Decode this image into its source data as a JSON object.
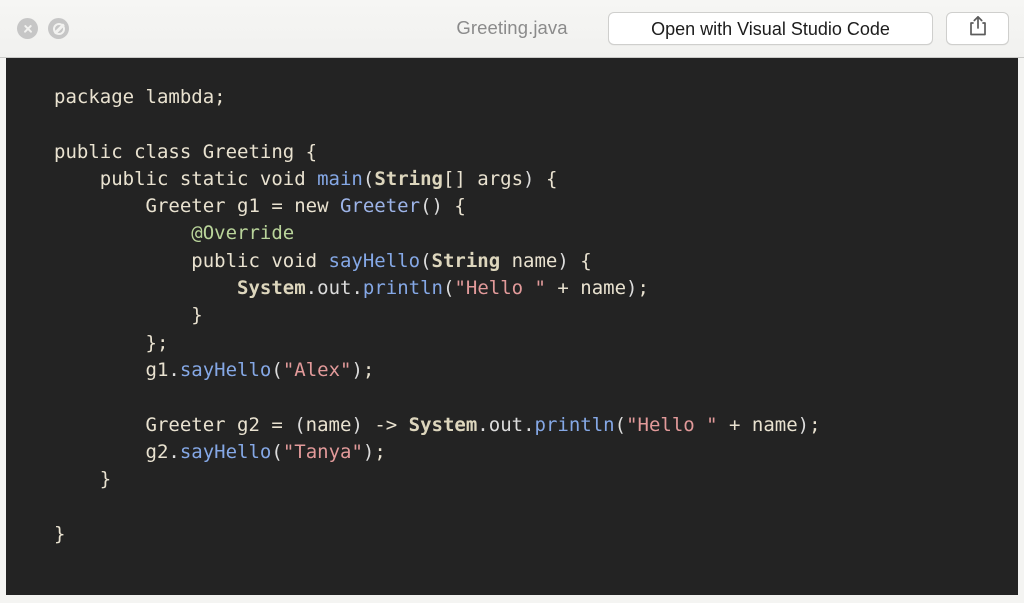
{
  "window": {
    "title": "Greeting.java"
  },
  "toolbar": {
    "close_button_icon": "close-x-icon",
    "disabled_button_icon": "prohibited-icon",
    "title": "Greeting.java",
    "open_with_label": "Open with Visual Studio Code",
    "share_icon": "share-upload-icon"
  },
  "code": {
    "language": "java",
    "background": "#232323",
    "default_color": "#e9e2d0",
    "colors": {
      "keyword": "#e9e2d0",
      "type": "#ddd6bd",
      "function": "#85a8e6",
      "class": "#9db4e8",
      "annotation": "#b9d49a",
      "string": "#e29a9a",
      "punctuation": "#dcdcdc"
    },
    "lines": [
      [
        {
          "t": "package lambda;",
          "c": "t-plain"
        }
      ],
      [],
      [
        {
          "t": "public class Greeting {",
          "c": "t-plain"
        }
      ],
      [
        {
          "t": "    public static void ",
          "c": "t-plain"
        },
        {
          "t": "main",
          "c": "t-fn"
        },
        {
          "t": "(",
          "c": "t-punct"
        },
        {
          "t": "String",
          "c": "t-type"
        },
        {
          "t": "[] args",
          "c": "t-plain"
        },
        {
          "t": ")",
          "c": "t-punct"
        },
        {
          "t": " {",
          "c": "t-plain"
        }
      ],
      [
        {
          "t": "        Greeter g1 = new ",
          "c": "t-plain"
        },
        {
          "t": "Greeter",
          "c": "t-cls"
        },
        {
          "t": "()",
          "c": "t-punct"
        },
        {
          "t": " {",
          "c": "t-plain"
        }
      ],
      [
        {
          "t": "            ",
          "c": "t-plain"
        },
        {
          "t": "@Override",
          "c": "t-ann"
        }
      ],
      [
        {
          "t": "            public void ",
          "c": "t-plain"
        },
        {
          "t": "sayHello",
          "c": "t-fn"
        },
        {
          "t": "(",
          "c": "t-punct"
        },
        {
          "t": "String",
          "c": "t-type"
        },
        {
          "t": " name",
          "c": "t-plain"
        },
        {
          "t": ")",
          "c": "t-punct"
        },
        {
          "t": " {",
          "c": "t-plain"
        }
      ],
      [
        {
          "t": "                ",
          "c": "t-plain"
        },
        {
          "t": "System",
          "c": "t-type"
        },
        {
          "t": ".",
          "c": "t-punct"
        },
        {
          "t": "out",
          "c": "t-punct"
        },
        {
          "t": ".",
          "c": "t-punct"
        },
        {
          "t": "println",
          "c": "t-fn"
        },
        {
          "t": "(",
          "c": "t-punct"
        },
        {
          "t": "\"Hello \"",
          "c": "t-str"
        },
        {
          "t": " + name",
          "c": "t-plain"
        },
        {
          "t": ")",
          "c": "t-punct"
        },
        {
          "t": ";",
          "c": "t-plain"
        }
      ],
      [
        {
          "t": "            }",
          "c": "t-plain"
        }
      ],
      [
        {
          "t": "        };",
          "c": "t-plain"
        }
      ],
      [
        {
          "t": "        g1",
          "c": "t-plain"
        },
        {
          "t": ".",
          "c": "t-punct"
        },
        {
          "t": "sayHello",
          "c": "t-fn"
        },
        {
          "t": "(",
          "c": "t-punct"
        },
        {
          "t": "\"Alex\"",
          "c": "t-str"
        },
        {
          "t": ")",
          "c": "t-punct"
        },
        {
          "t": ";",
          "c": "t-plain"
        }
      ],
      [],
      [
        {
          "t": "        Greeter g2 = ",
          "c": "t-plain"
        },
        {
          "t": "(",
          "c": "t-punct"
        },
        {
          "t": "name",
          "c": "t-plain"
        },
        {
          "t": ")",
          "c": "t-punct"
        },
        {
          "t": " -> ",
          "c": "t-plain"
        },
        {
          "t": "System",
          "c": "t-type"
        },
        {
          "t": ".",
          "c": "t-punct"
        },
        {
          "t": "out",
          "c": "t-punct"
        },
        {
          "t": ".",
          "c": "t-punct"
        },
        {
          "t": "println",
          "c": "t-fn"
        },
        {
          "t": "(",
          "c": "t-punct"
        },
        {
          "t": "\"Hello \"",
          "c": "t-str"
        },
        {
          "t": " + name",
          "c": "t-plain"
        },
        {
          "t": ")",
          "c": "t-punct"
        },
        {
          "t": ";",
          "c": "t-plain"
        }
      ],
      [
        {
          "t": "        g2",
          "c": "t-plain"
        },
        {
          "t": ".",
          "c": "t-punct"
        },
        {
          "t": "sayHello",
          "c": "t-fn"
        },
        {
          "t": "(",
          "c": "t-punct"
        },
        {
          "t": "\"Tanya\"",
          "c": "t-str"
        },
        {
          "t": ")",
          "c": "t-punct"
        },
        {
          "t": ";",
          "c": "t-plain"
        }
      ],
      [
        {
          "t": "    }",
          "c": "t-plain"
        }
      ],
      [],
      [
        {
          "t": "}",
          "c": "t-plain"
        }
      ]
    ]
  }
}
